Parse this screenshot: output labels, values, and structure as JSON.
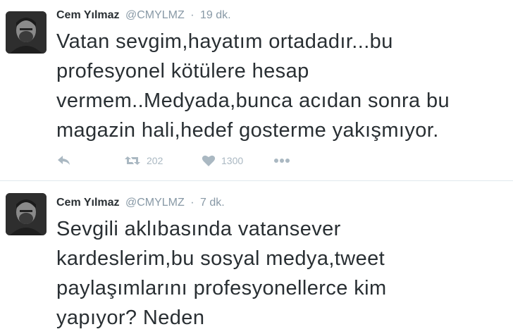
{
  "tweets": [
    {
      "name": "Cem Yılmaz",
      "handle": "@CMYLMZ",
      "separator": "·",
      "time": "19 dk.",
      "lines": [
        "Vatan sevgim,hayatım ortadadır...bu",
        "profesyonel kötülere hesap",
        "vermem..Medyada,bunca acıdan sonra bu",
        "magazin hali,hedef gosterme yakışmıyor."
      ],
      "actions": {
        "reply_icon": "reply-icon",
        "retweet_icon": "retweet-icon",
        "retweet_count": "202",
        "like_icon": "heart-icon",
        "like_count": "1300",
        "more_icon": "more-icon"
      }
    },
    {
      "name": "Cem Yılmaz",
      "handle": "@CMYLMZ",
      "separator": "·",
      "time": "7 dk.",
      "lines": [
        "Sevgili aklıbasında vatansever",
        "kardeslerim,bu sosyal medya,tweet",
        "paylaşımlarını profesyonellerce kim",
        "yapıyor? Neden"
      ]
    }
  ],
  "colors": {
    "text": "#292f33",
    "muted": "#8899a6",
    "icon": "#aab8c2",
    "divider": "#e1e8ed"
  }
}
